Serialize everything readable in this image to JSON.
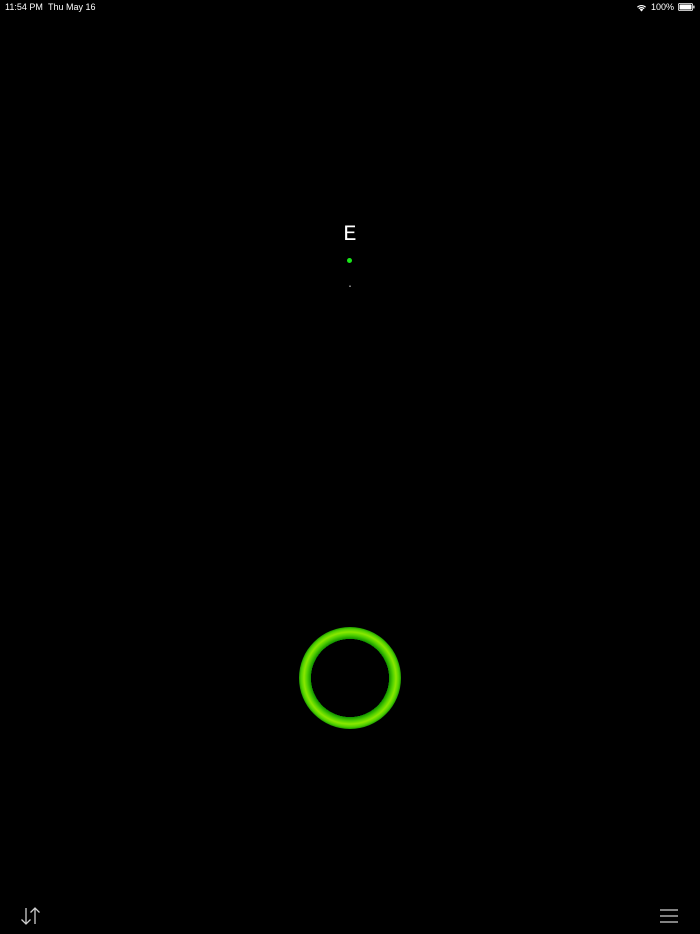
{
  "status_bar": {
    "time": "11:54 PM",
    "date": "Thu May 16",
    "battery": "100%",
    "icons": [
      "wifi-icon",
      "battery-icon"
    ]
  },
  "display": {
    "letter": "E",
    "morse": "."
  },
  "key": {
    "icon": "telegraph-key-ring",
    "color": "#4fd000"
  },
  "toolbar": {
    "left_icon": "swap-arrows-icon",
    "right_icon": "menu-icon"
  },
  "colors": {
    "background": "#000000",
    "accent": "#19e619"
  }
}
